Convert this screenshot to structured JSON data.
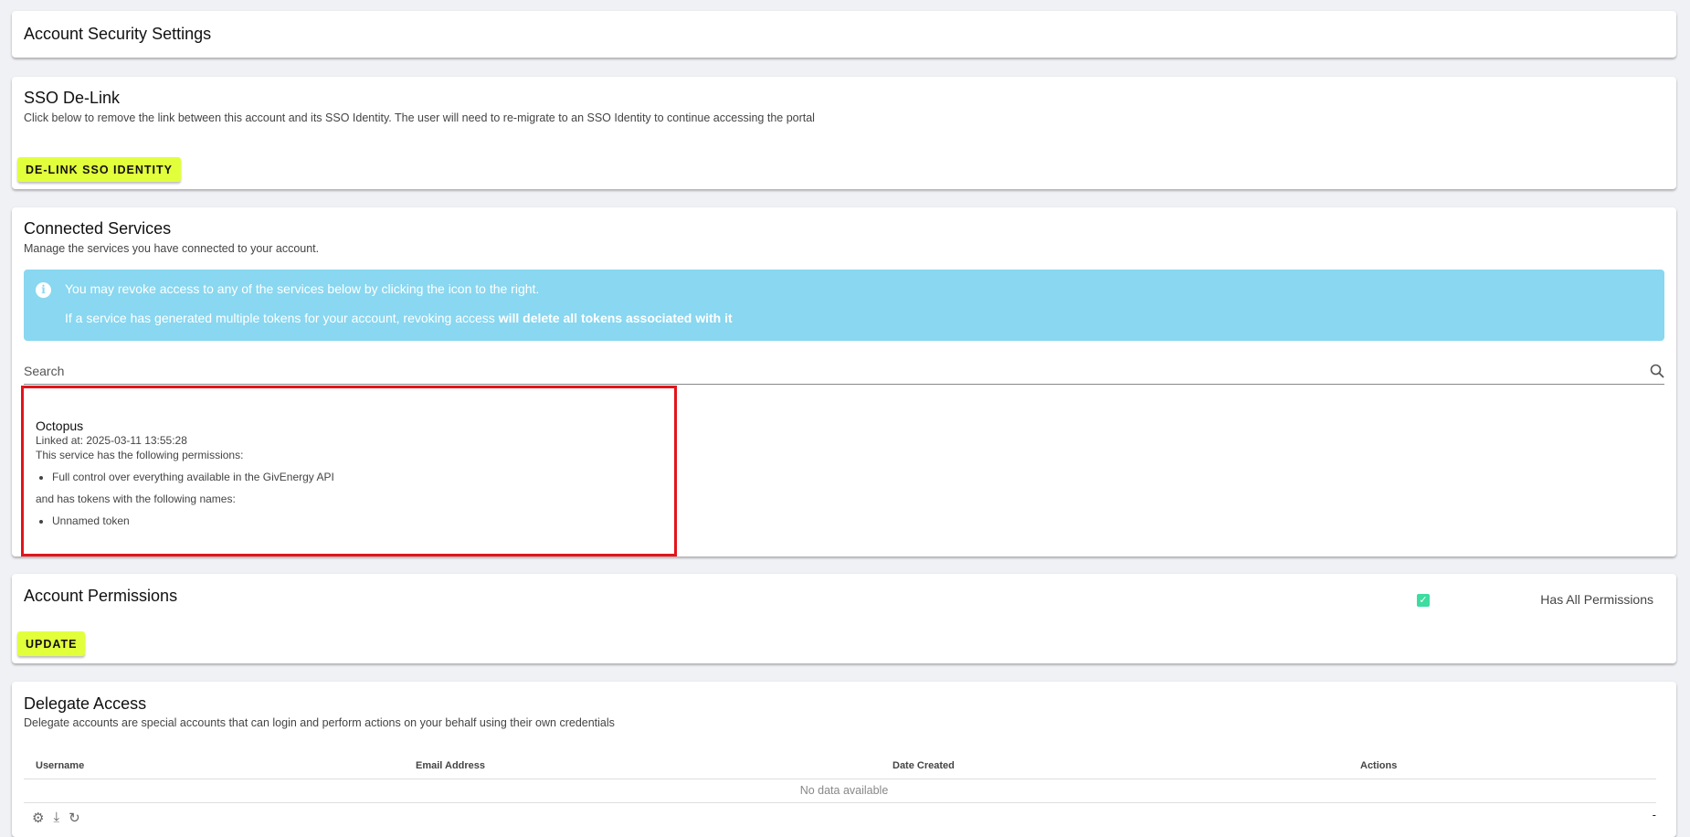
{
  "header": {
    "title": "Account Security Settings"
  },
  "sso": {
    "title": "SSO De-Link",
    "description": "Click below to remove the link between this account and its SSO Identity. The user will need to re-migrate to an SSO Identity to continue accessing the portal",
    "button": "DE-LINK SSO IDENTITY"
  },
  "connected": {
    "title": "Connected Services",
    "description": "Manage the services you have connected to your account.",
    "alert": {
      "line1": "You may revoke access to any of the services below by clicking the icon to the right.",
      "line2_prefix": "If a service has generated multiple tokens for your account, revoking access ",
      "line2_bold": "will delete all tokens associated with it"
    },
    "search_label": "Search",
    "service": {
      "name": "Octopus",
      "linked_at": "Linked at: 2025-03-11 13:55:28",
      "perm_intro": "This service has the following permissions:",
      "permissions": [
        "Full control over everything available in the GivEnergy API"
      ],
      "token_intro": "and has tokens with the following names:",
      "tokens": [
        "Unnamed token"
      ]
    }
  },
  "permissions": {
    "title": "Account Permissions",
    "button": "UPDATE",
    "checkbox_label": "Has All Permissions",
    "checked": true
  },
  "delegate": {
    "title": "Delegate Access",
    "description": "Delegate accounts are special accounts that can login and perform actions on your behalf using their own credentials",
    "columns": [
      "Username",
      "Email Address",
      "Date Created",
      "Actions"
    ],
    "empty": "No data available",
    "footer_right": "-"
  },
  "colors": {
    "accent": "#e2ff3c",
    "info": "#89d7f0",
    "check": "#3ddca0",
    "highlight": "#e3141b"
  }
}
